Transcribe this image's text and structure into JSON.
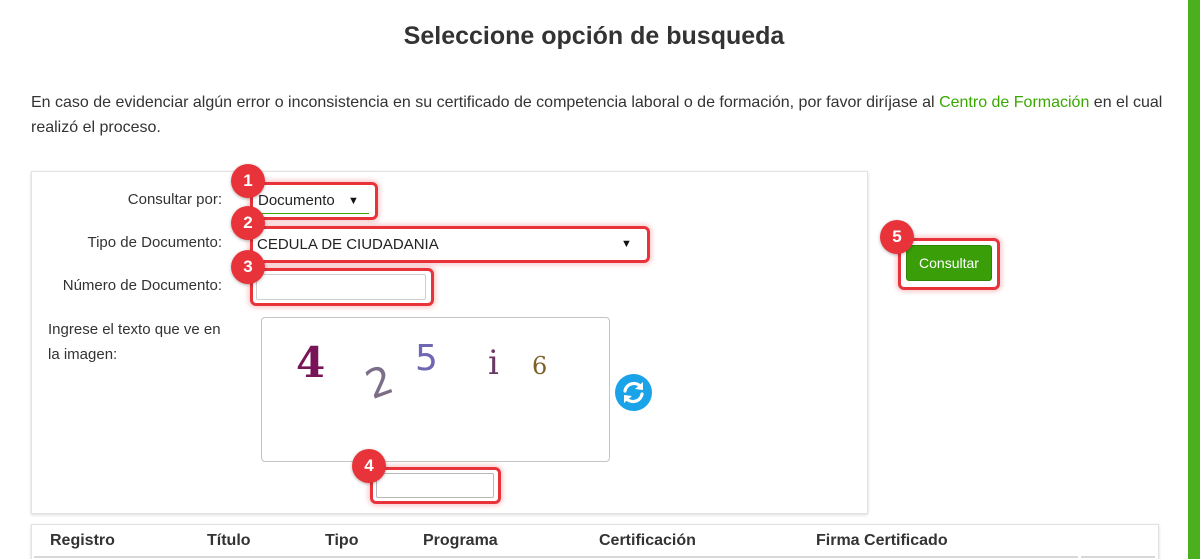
{
  "page_title": "Seleccione opción de busqueda",
  "notice": {
    "text_before": "En caso de evidenciar algún error o inconsistencia en su certificado de competencia laboral o de formación, por favor diríjase al ",
    "link_text": "Centro de Formación",
    "text_after": " en el cual realizó el proceso."
  },
  "form": {
    "consultar_por_label": "Consultar por:",
    "consultar_por_value": "Documento",
    "tipo_documento_label": "Tipo de Documento:",
    "tipo_documento_value": "CEDULA DE CIUDADANIA",
    "numero_documento_label": "Número de Documento:",
    "numero_documento_value": "",
    "captcha_label": "Ingrese el texto que ve en la imagen:",
    "captcha_chars": [
      "4",
      "2",
      "5",
      "i",
      "6"
    ],
    "captcha_input_value": "",
    "refresh_icon": "refresh-icon"
  },
  "actions": {
    "consultar_label": "Consultar"
  },
  "badges": [
    "1",
    "2",
    "3",
    "4",
    "5"
  ],
  "table": {
    "headers": [
      "Registro",
      "Título",
      "Tipo",
      "Programa",
      "Certificación",
      "Firma Certificado"
    ]
  },
  "colors": {
    "accent_green": "#39a900",
    "button_green": "#3a9e09",
    "highlight_red": "#e8333a",
    "refresh_blue": "#1aa3e8"
  }
}
